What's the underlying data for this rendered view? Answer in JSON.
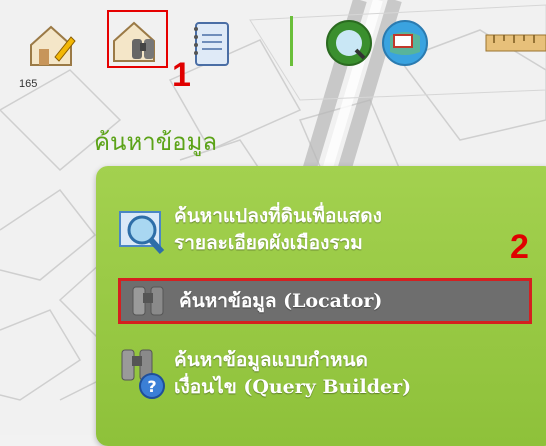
{
  "map": {
    "number_label": "165"
  },
  "toolbar": {
    "items": [
      {
        "name": "edit-document-icon"
      },
      {
        "name": "binoculars-house-icon"
      },
      {
        "name": "notepad-icon"
      },
      {
        "name": "globe-search-icon"
      },
      {
        "name": "globe-window-icon"
      },
      {
        "name": "ruler-icon"
      }
    ]
  },
  "annotations": {
    "step1": "1",
    "step2": "2"
  },
  "section": {
    "title": "ค้นหาข้อมูล"
  },
  "menu": {
    "items": [
      {
        "label_line1": "ค้นหาแปลงที่ดินเพื่อแสดง",
        "label_line2": "รายละเอียดผังเมืองรวม",
        "icon": "map-search-icon"
      },
      {
        "label": "ค้นหาข้อมูล (Locator)",
        "icon": "binoculars-icon"
      },
      {
        "label_line1": "ค้นหาข้อมูลแบบกำหนด",
        "label_line2": "เงื่อนไข (Query Builder)",
        "icon": "binoculars-question-icon"
      }
    ]
  },
  "colors": {
    "accent": "#5ca318",
    "panel": "#9acb45",
    "highlight": "#e60000"
  }
}
